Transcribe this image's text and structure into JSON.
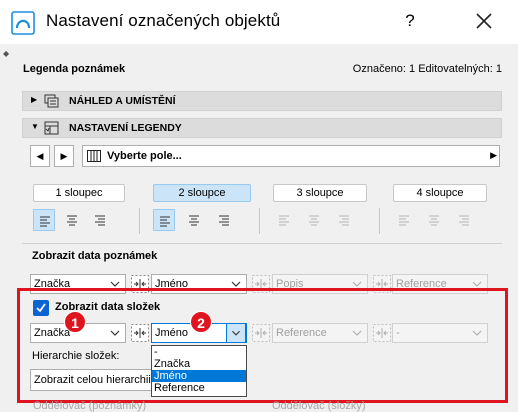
{
  "window": {
    "title": "Nastavení označených objektů",
    "help_label": "?"
  },
  "header": {
    "section_label": "Legenda poznámek",
    "selection_info": "Označeno: 1 Editovatelných: 1"
  },
  "panels": {
    "preview": "NÁHLED A UMÍSTĚNÍ",
    "legend": "NASTAVENÍ LEGENDY"
  },
  "field_select": {
    "value": "Vyberte pole..."
  },
  "columns": [
    "1 sloupec",
    "2 sloupce",
    "3 sloupce",
    "4 sloupce"
  ],
  "active_column": "2 sloupce",
  "note_data": {
    "label": "Zobrazit data poznámek",
    "dropdowns": [
      "Značka",
      "Jméno",
      "Popis",
      "Reference"
    ]
  },
  "folder_data": {
    "label": "Zobrazit data složek",
    "checked": true,
    "dropdowns": [
      "Značka",
      "Jméno",
      "Reference",
      "-"
    ],
    "hierarchy_label": "Hierarchie složek:",
    "hierarchy_value": "Zobrazit celou hierarchii",
    "dropdown_options": [
      "-",
      "Značka",
      "Jméno",
      "Reference"
    ],
    "highlighted_option": "Jméno"
  },
  "badges": [
    "1",
    "2"
  ],
  "bottom_labels": [
    "Oddělovač (poznámky)",
    "Oddělovač (složky)"
  ],
  "colors": {
    "accent": "#0078d7",
    "highlight_box": "#e0141e",
    "active_column_bg": "#cce4f7",
    "panel_header_bg": "#dcdcdc"
  }
}
